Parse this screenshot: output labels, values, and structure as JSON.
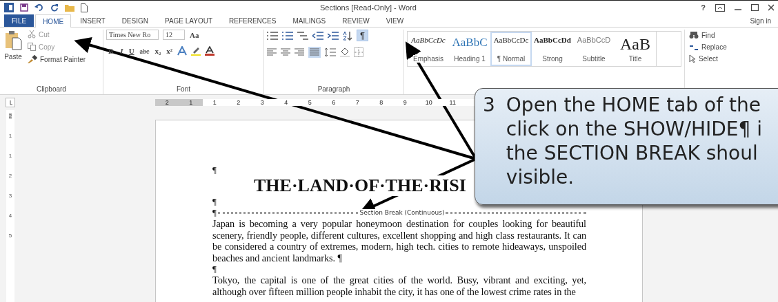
{
  "window": {
    "title": "Sections [Read-Only] - Word",
    "help": "?",
    "sign_in": "Sign in"
  },
  "tabs": [
    {
      "label": "FILE",
      "kind": "file",
      "selected": false
    },
    {
      "label": "HOME",
      "kind": "tab",
      "selected": true
    },
    {
      "label": "INSERT",
      "kind": "tab",
      "selected": false
    },
    {
      "label": "DESIGN",
      "kind": "tab",
      "selected": false
    },
    {
      "label": "PAGE LAYOUT",
      "kind": "tab",
      "selected": false
    },
    {
      "label": "REFERENCES",
      "kind": "tab",
      "selected": false
    },
    {
      "label": "MAILINGS",
      "kind": "tab",
      "selected": false
    },
    {
      "label": "REVIEW",
      "kind": "tab",
      "selected": false
    },
    {
      "label": "VIEW",
      "kind": "tab",
      "selected": false
    }
  ],
  "clipboard": {
    "paste": "Paste",
    "cut": "Cut",
    "copy": "Copy",
    "format_painter": "Format Painter",
    "label": "Clipboard"
  },
  "font": {
    "name": "Times New Ro",
    "size": "12",
    "case": "Aa",
    "buttons": [
      "B",
      "I",
      "U",
      "abc",
      "x₂",
      "x²"
    ],
    "label": "Font"
  },
  "paragraph": {
    "show_hide": "¶",
    "show_hide_on": true,
    "label": "Paragraph"
  },
  "styles": [
    {
      "preview": "AaBbCcDc",
      "name": "Emphasis",
      "kind": "emphasis",
      "selected": false
    },
    {
      "preview": "AaBbC",
      "name": "Heading 1",
      "kind": "heading",
      "selected": false
    },
    {
      "preview": "AaBbCcDc",
      "name": "¶ Normal",
      "kind": "normal",
      "selected": true
    },
    {
      "preview": "AaBbCcDd",
      "name": "Strong",
      "kind": "strong",
      "selected": false
    },
    {
      "preview": "AaBbCcD",
      "name": "Subtitle",
      "kind": "subtitle",
      "selected": false
    },
    {
      "preview": "AaB",
      "name": "Title",
      "kind": "title",
      "selected": false
    }
  ],
  "editing": {
    "find": "Find",
    "replace": "Replace",
    "select": "Select"
  },
  "ruler": {
    "numbers": [
      "2",
      "1",
      "1",
      "2",
      "3",
      "4",
      "5",
      "6",
      "7",
      "8",
      "9",
      "10",
      "11"
    ],
    "vertical_numbers": [
      "2",
      "1",
      "1",
      "2",
      "3",
      "4",
      "5"
    ]
  },
  "document": {
    "blocks": [
      {
        "kind": "mark",
        "text": "¶"
      },
      {
        "kind": "title",
        "text": "THE·LAND·OF·THE·RISI"
      },
      {
        "kind": "mark",
        "text": "¶"
      },
      {
        "kind": "break",
        "text": "¶",
        "label": "Section Break (Continuous)"
      },
      {
        "kind": "para",
        "text": "Japan is becoming a very popular honeymoon destination for couples looking for beautiful scenery, friendly people, different cultures, excellent shopping and high class restaurants. It can be considered a country of extremes, modern, high tech. cities to remote hideaways, unspoiled beaches and ancient landmarks. ¶"
      },
      {
        "kind": "mark",
        "text": "¶"
      },
      {
        "kind": "para",
        "text": "Tokyo, the capital is one of the great cities of the world. Busy, vibrant and exciting, yet, although over fifteen million people inhabit the city, it has one of the lowest crime rates in the"
      }
    ]
  },
  "callout": {
    "number": "3",
    "lines": [
      "Open the HOME tab of the",
      "click on the SHOW/HIDE¶ i",
      "the SECTION BREAK shoul",
      "visible."
    ]
  }
}
